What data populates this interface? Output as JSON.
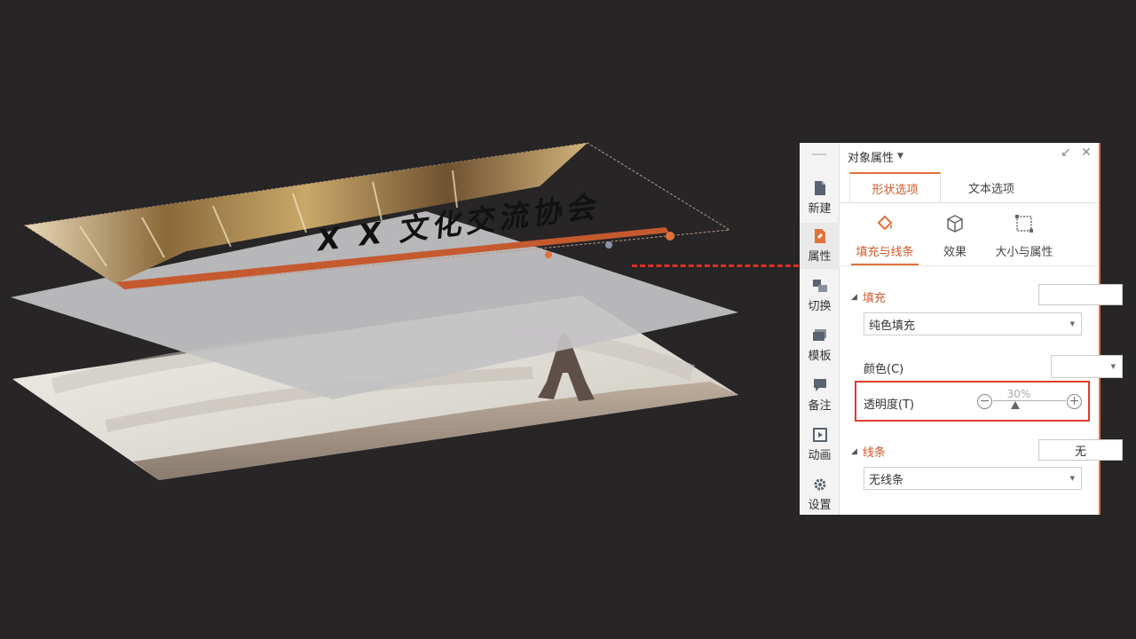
{
  "slide": {
    "title_text": "X X 文化交流协会"
  },
  "panel": {
    "title": "对象属性",
    "sidebar": [
      {
        "label": "新建",
        "icon": "new-document-icon"
      },
      {
        "label": "属性",
        "icon": "properties-icon"
      },
      {
        "label": "切换",
        "icon": "transition-icon"
      },
      {
        "label": "模板",
        "icon": "template-icon"
      },
      {
        "label": "备注",
        "icon": "note-icon"
      },
      {
        "label": "动画",
        "icon": "animation-icon"
      },
      {
        "label": "设置",
        "icon": "gear-icon"
      }
    ],
    "tabs": [
      "形状选项",
      "文本选项"
    ],
    "subtabs": [
      {
        "label": "填充与线条",
        "icon": "paint-bucket-icon"
      },
      {
        "label": "效果",
        "icon": "cube-icon"
      },
      {
        "label": "大小与属性",
        "icon": "size-frame-icon"
      }
    ],
    "fill": {
      "section_title": "填充",
      "type_value": "纯色填充",
      "color_label": "颜色(C)",
      "transparency_label": "透明度(T)",
      "transparency_value": "30%",
      "transparency_fraction": 0.3
    },
    "line": {
      "section_title": "线条",
      "button_label": "无",
      "type_value": "无线条"
    }
  },
  "colors": {
    "accent": "#e3703a",
    "highlight": "#e03a2e",
    "background": "#272526"
  }
}
